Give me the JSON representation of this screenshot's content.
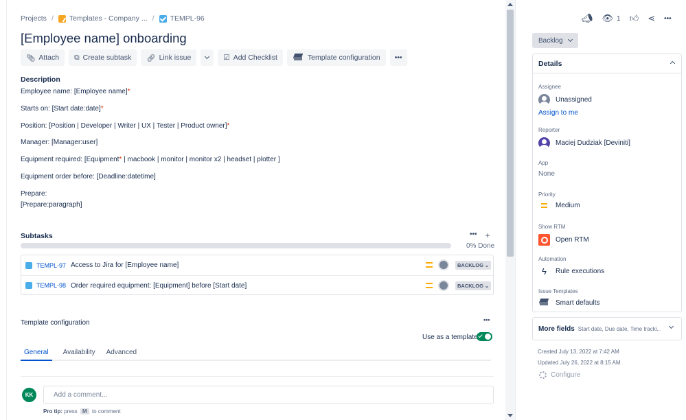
{
  "breadcrumb": {
    "projects": "Projects",
    "project": "Templates - Company ...",
    "issue_key": "TEMPL-96"
  },
  "issue": {
    "title": "[Employee name] onboarding"
  },
  "toolbar": {
    "attach": "Attach",
    "create_subtask": "Create subtask",
    "link_issue": "Link issue",
    "add_checklist": "Add Checklist",
    "template_configuration": "Template configuration"
  },
  "description": {
    "label": "Description",
    "lines": [
      {
        "text": "Employee name: [Employee name]",
        "required": "*"
      },
      {
        "text": "Starts on: [Start date:date]",
        "required": "*"
      },
      {
        "text": "Position: [Position | Developer | Writer | UX | Tester | Product owner]",
        "required": "*"
      },
      {
        "text": "Manager: [Manager:user]",
        "required": ""
      },
      {
        "text": "Equipment required: [Equipment",
        "required": "*",
        "suffix": " | macbook | monitor | monitor x2 | headset | plotter ]"
      },
      {
        "text": "Equipment order before: [Deadline:datetime]",
        "required": ""
      },
      {
        "text": "Prepare:",
        "required": ""
      },
      {
        "text": "[Prepare:paragraph]",
        "required": ""
      }
    ]
  },
  "subtasks": {
    "label": "Subtasks",
    "progress_percent": 0,
    "progress_text": "0% Done",
    "items": [
      {
        "key": "TEMPL-97",
        "summary": "Access to Jira for [Employee name]",
        "status": "BACKLOG"
      },
      {
        "key": "TEMPL-98",
        "summary": "Order required equipment: [Equipment] before [Start date]",
        "status": "BACKLOG"
      }
    ]
  },
  "template_config": {
    "label": "Template configuration",
    "use_as_template_label": "Use as a template",
    "use_as_template": true,
    "tabs": [
      "General",
      "Availability",
      "Advanced"
    ],
    "active_tab": "General"
  },
  "comment": {
    "avatar_initials": "KK",
    "placeholder": "Add a comment...",
    "protip_prefix": "Pro tip:",
    "protip_press": "press",
    "protip_key": "M",
    "protip_suffix": "to comment"
  },
  "sidebar": {
    "watchers_count": "1",
    "status": "Backlog",
    "details_label": "Details",
    "assignee_label": "Assignee",
    "assignee_value": "Unassigned",
    "assign_to_me": "Assign to me",
    "reporter_label": "Reporter",
    "reporter_value": "Maciej Dudziak [Deviniti]",
    "app_label": "App",
    "app_value": "None",
    "priority_label": "Priority",
    "priority_value": "Medium",
    "show_rtm_label": "Show RTM",
    "show_rtm_value": "Open RTM",
    "automation_label": "Automation",
    "automation_value": "Rule executions",
    "issue_templates_label": "Issue Templates",
    "issue_templates_value": "Smart defaults",
    "more_fields_label": "More fields",
    "more_fields_sub": "Start date, Due date, Time tracki...",
    "created": "Created July 13, 2022 at 7:42 AM",
    "updated": "Updated July 26, 2022 at 8:15 AM",
    "configure": "Configure"
  },
  "colors": {
    "link": "#0052cc",
    "priority_medium": "#ffab00",
    "toggle_on": "#00875a",
    "avatar_kk": "#00875a"
  }
}
